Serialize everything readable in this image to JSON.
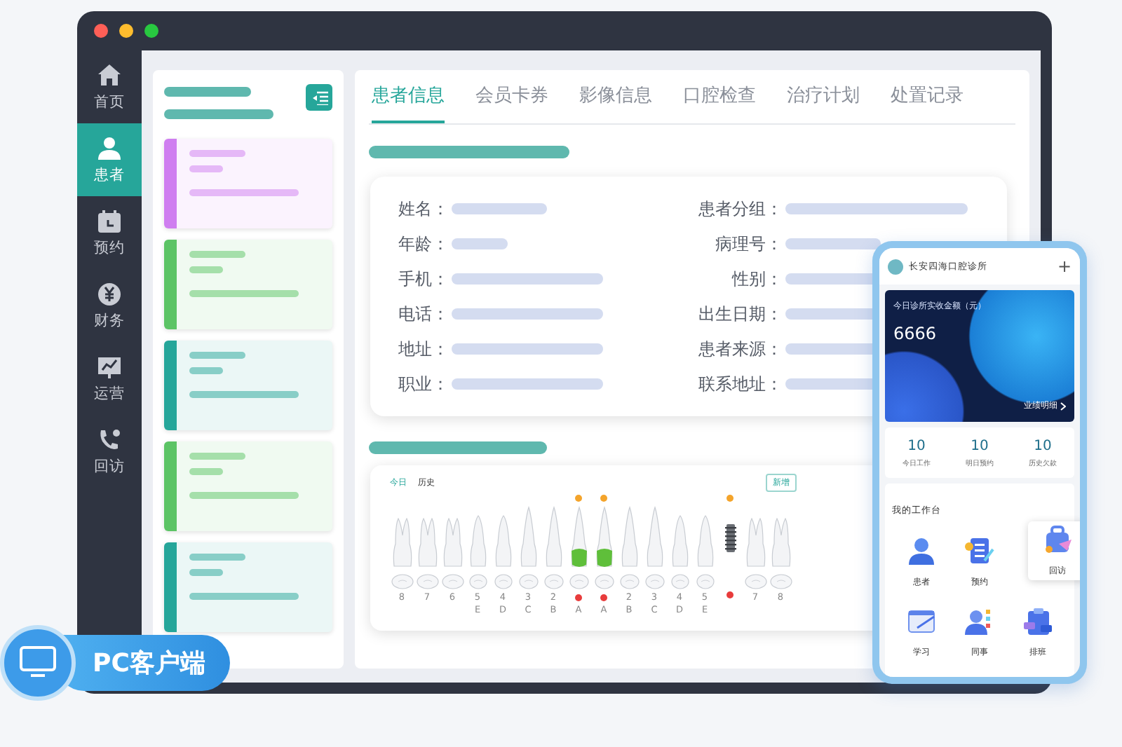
{
  "sidebar": {
    "items": [
      {
        "label": "首页",
        "kind": "home",
        "selected": false
      },
      {
        "label": "患者",
        "kind": "person",
        "selected": true
      },
      {
        "label": "预约",
        "kind": "calendar",
        "selected": false
      },
      {
        "label": "财务",
        "kind": "yen",
        "selected": false
      },
      {
        "label": "运营",
        "kind": "chart",
        "selected": false
      },
      {
        "label": "回访",
        "kind": "phone",
        "selected": false
      }
    ]
  },
  "patient_list": {
    "cards": [
      {
        "color": "#cf7ef0"
      },
      {
        "color": "#5cc465"
      },
      {
        "color": "#26a69a"
      },
      {
        "color": "#5cc465"
      },
      {
        "color": "#26a69a"
      }
    ]
  },
  "tabs": [
    {
      "label": "患者信息",
      "selected": true
    },
    {
      "label": "会员卡券",
      "selected": false
    },
    {
      "label": "影像信息",
      "selected": false
    },
    {
      "label": "口腔检查",
      "selected": false
    },
    {
      "label": "治疗计划",
      "selected": false
    },
    {
      "label": "处置记录",
      "selected": false
    }
  ],
  "patient_info": {
    "fields": [
      {
        "label": "姓名："
      },
      {
        "label": "患者分组："
      },
      {
        "label": "年龄："
      },
      {
        "label": "病理号："
      },
      {
        "label": "手机："
      },
      {
        "label": "性别："
      },
      {
        "label": "电话："
      },
      {
        "label": "出生日期："
      },
      {
        "label": "地址："
      },
      {
        "label": "患者来源："
      },
      {
        "label": "职业："
      },
      {
        "label": "联系地址："
      }
    ]
  },
  "tooth_chart": {
    "tabs": [
      {
        "label": "今日",
        "selected": true
      },
      {
        "label": "历史",
        "selected": false
      }
    ],
    "button": "新增",
    "teeth": [
      {
        "kind": "molar",
        "crown": false,
        "flag": false
      },
      {
        "kind": "molar",
        "crown": false,
        "flag": false
      },
      {
        "kind": "molar",
        "crown": false,
        "flag": false
      },
      {
        "kind": "premolar",
        "crown": false,
        "flag": false
      },
      {
        "kind": "premolar",
        "crown": false,
        "flag": false
      },
      {
        "kind": "anterior",
        "crown": false,
        "flag": false
      },
      {
        "kind": "anterior",
        "crown": false,
        "flag": false
      },
      {
        "kind": "anterior",
        "crown": true,
        "flag": true
      },
      {
        "kind": "anterior",
        "crown": true,
        "flag": true
      },
      {
        "kind": "anterior",
        "crown": false,
        "flag": false
      },
      {
        "kind": "anterior",
        "crown": false,
        "flag": false
      },
      {
        "kind": "premolar",
        "crown": false,
        "flag": false
      },
      {
        "kind": "premolar",
        "crown": false,
        "flag": false
      },
      {
        "kind": "implant",
        "flag": true
      },
      {
        "kind": "molar",
        "crown": false,
        "flag": false
      },
      {
        "kind": "molar",
        "crown": false,
        "flag": false
      }
    ],
    "labels": [
      {
        "number": "8",
        "marked": false
      },
      {
        "number": "7",
        "marked": false
      },
      {
        "number": "6",
        "marked": false
      },
      {
        "number": "5",
        "letter": "E",
        "marked": false
      },
      {
        "number": "4",
        "letter": "D",
        "marked": false
      },
      {
        "number": "3",
        "letter": "C",
        "marked": false
      },
      {
        "number": "2",
        "letter": "B",
        "marked": false
      },
      {
        "letter": "A",
        "marked": true
      },
      {
        "letter": "A",
        "marked": true
      },
      {
        "number": "2",
        "letter": "B",
        "marked": false
      },
      {
        "number": "3",
        "letter": "C",
        "marked": false
      },
      {
        "number": "4",
        "letter": "D",
        "marked": false
      },
      {
        "number": "5",
        "letter": "E",
        "marked": false
      },
      {
        "marked": true
      },
      {
        "number": "7",
        "marked": false
      },
      {
        "number": "8",
        "marked": false
      }
    ]
  },
  "phone": {
    "clinic": "长安四海口腔诊所",
    "add": "+",
    "revenue": {
      "title": "今日诊所实收金额（元）",
      "amount": "6666",
      "link": "业绩明细"
    },
    "stats": [
      {
        "value": "10",
        "label": "今日工作"
      },
      {
        "value": "10",
        "label": "明日预约"
      },
      {
        "value": "10",
        "label": "历史欠款"
      }
    ],
    "workbench": {
      "title": "我的工作台",
      "items": [
        {
          "label": "患者",
          "kind": "person",
          "selected": false
        },
        {
          "label": "预约",
          "kind": "form",
          "selected": false
        },
        {
          "label": "回访",
          "kind": "bag",
          "selected": true
        },
        {
          "label": "学习",
          "kind": "notebook",
          "selected": false
        },
        {
          "label": "同事",
          "kind": "team",
          "selected": false
        },
        {
          "label": "排班",
          "kind": "clipboard",
          "selected": false
        }
      ]
    }
  },
  "badge": {
    "label": "PC客户端"
  }
}
